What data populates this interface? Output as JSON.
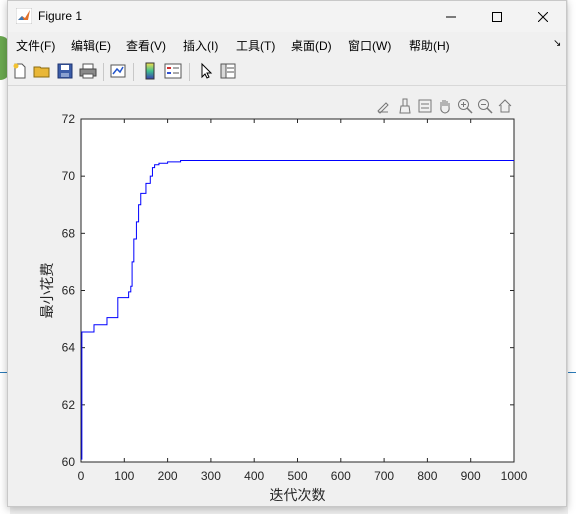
{
  "window": {
    "title": "Figure 1"
  },
  "menu": [
    "文件(F)",
    "编辑(E)",
    "查看(V)",
    "插入(I)",
    "工具(T)",
    "桌面(D)",
    "窗口(W)",
    "帮助(H)"
  ],
  "toolbar_icons": [
    "new-figure-icon",
    "open-file-icon",
    "save-icon",
    "print-icon",
    "link-plot-icon",
    "colorbar-icon",
    "legend-icon",
    "pointer-icon",
    "property-editor-icon"
  ],
  "axes_toolbar_icons": [
    "edit-plot-icon",
    "brush-icon",
    "data-tips-icon",
    "pan-icon",
    "zoom-in-icon",
    "zoom-out-icon",
    "home-icon"
  ],
  "colors": {
    "line": "#0000ff",
    "axes_bg": "#ffffff",
    "figure_bg": "#f0f0f0"
  },
  "chart_data": {
    "type": "line",
    "xlabel": "迭代次数",
    "ylabel": "最小花费",
    "xlim": [
      0,
      1000
    ],
    "ylim": [
      60,
      72
    ],
    "xticks": [
      "0",
      "100",
      "200",
      "300",
      "400",
      "500",
      "600",
      "700",
      "800",
      "900",
      "1000"
    ],
    "yticks": [
      "60",
      "62",
      "64",
      "66",
      "68",
      "70",
      "72"
    ],
    "grid": false,
    "series": [
      {
        "x": [
          0,
          2,
          30,
          60,
          85,
          110,
          115,
          118,
          122,
          128,
          133,
          138,
          150,
          160,
          165,
          170,
          180,
          200,
          230,
          1000
        ],
        "y": [
          60.1,
          64.55,
          64.8,
          65.05,
          65.75,
          65.95,
          66.15,
          67.0,
          67.8,
          68.4,
          69.0,
          69.4,
          69.75,
          70.0,
          70.3,
          70.4,
          70.45,
          70.5,
          70.55,
          70.55
        ]
      }
    ]
  }
}
